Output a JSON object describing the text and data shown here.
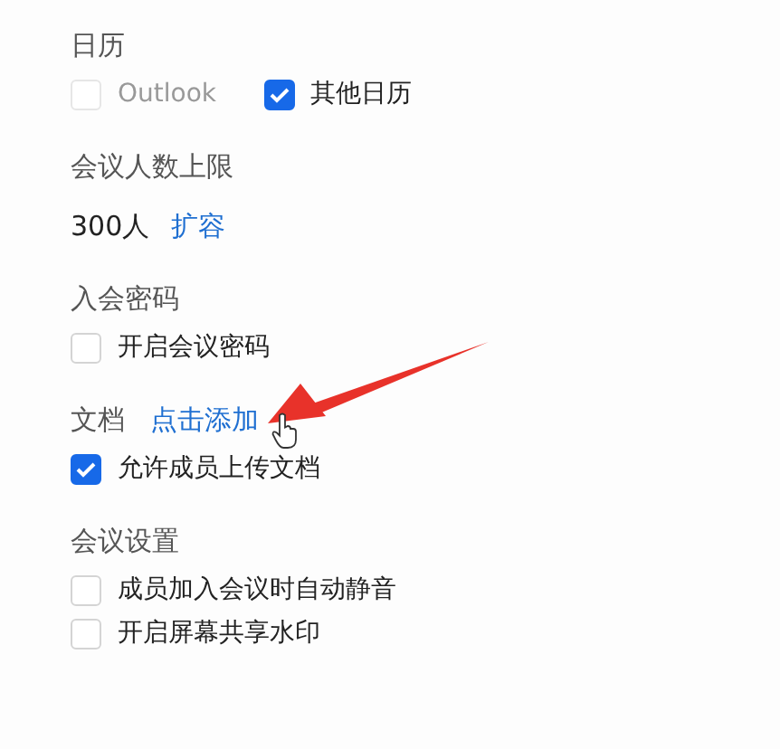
{
  "sections": [
    {
      "kind": "checkboxes",
      "title": "日历",
      "inline": true,
      "options": [
        {
          "label": "Outlook",
          "checked": false,
          "disabled": true
        },
        {
          "label": "其他日历",
          "checked": true,
          "disabled": false
        }
      ]
    },
    {
      "kind": "value",
      "title": "会议人数上限",
      "value": "300人",
      "link": "扩容"
    },
    {
      "kind": "checkboxes",
      "title": "入会密码",
      "inline": false,
      "options": [
        {
          "label": "开启会议密码",
          "checked": false,
          "disabled": false
        }
      ]
    },
    {
      "kind": "checkboxes",
      "title": "文档",
      "link": "点击添加",
      "inline": false,
      "options": [
        {
          "label": "允许成员上传文档",
          "checked": true,
          "disabled": false
        }
      ]
    },
    {
      "kind": "checkboxes",
      "title": "会议设置",
      "inline": false,
      "options": [
        {
          "label": "成员加入会议时自动静音",
          "checked": false,
          "disabled": false
        },
        {
          "label": "开启屏幕共享水印",
          "checked": false,
          "disabled": false
        }
      ]
    }
  ]
}
